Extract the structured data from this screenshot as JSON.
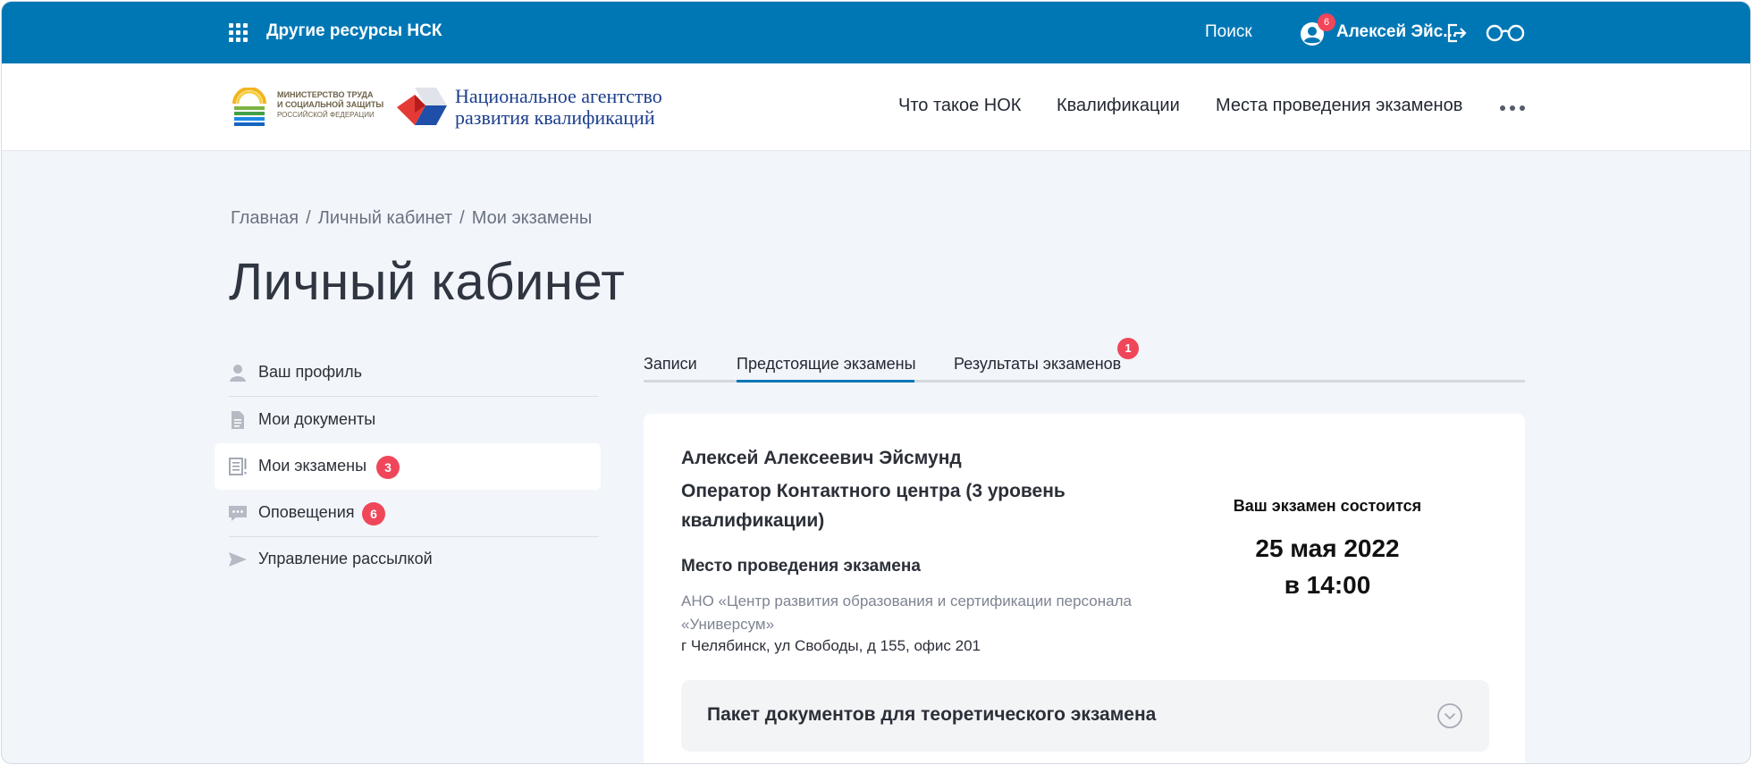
{
  "topbar": {
    "other_resources": "Другие ресурсы НСК",
    "search": "Поиск",
    "notifications_count": "6",
    "username": "Алексей Эйс...",
    "bg_color": "#0077b5"
  },
  "header": {
    "ministry_line1": "МИНИСТЕРСТВО ТРУДА",
    "ministry_line2": "И СОЦИАЛЬНОЙ ЗАЩИТЫ",
    "ministry_line3": "РОССИЙСКОЙ ФЕДЕРАЦИИ",
    "agency_line1": "Национальное агентство",
    "agency_line2": "развития квалификаций",
    "nav": [
      {
        "label": "Что такое НОК"
      },
      {
        "label": "Квалификации"
      },
      {
        "label": "Места проведения экзаменов"
      }
    ]
  },
  "breadcrumb": [
    "Главная",
    "Личный кабинет",
    "Мои экзамены"
  ],
  "page_title": "Личный кабинет",
  "sidebar": {
    "items": [
      {
        "label": "Ваш профиль",
        "icon": "user-icon"
      },
      {
        "label": "Мои документы",
        "icon": "document-icon"
      },
      {
        "label": "Мои экзамены",
        "icon": "exam-icon",
        "badge": "3",
        "active": true
      },
      {
        "label": "Оповещения",
        "icon": "message-icon",
        "badge": "6"
      },
      {
        "label": "Управление рассылкой",
        "icon": "send-icon"
      }
    ]
  },
  "tabs": [
    {
      "label": "Записи"
    },
    {
      "label": "Предстоящие экзамены",
      "active": true
    },
    {
      "label": "Результаты экзаменов",
      "badge": "1"
    }
  ],
  "exam_card": {
    "candidate": "Алексей Алексеевич Эйсмунд",
    "qualification": "Оператор Контактного центра (3 уровень квалификации)",
    "place_heading": "Место проведения экзамена",
    "organization": "АНО «Центр развития образования и сертификации персонала «Универсум»",
    "address": "г Челябинск, ул Свободы, д 155, офис 201",
    "when_heading": "Ваш экзамен состоится",
    "date": "25 мая 2022",
    "time": "в 14:00",
    "accordion_label": "Пакет документов для теоретического экзамена"
  },
  "colors": {
    "accent": "#0077b5",
    "badge": "#f0465a",
    "page_bg": "#f2f5fa"
  }
}
